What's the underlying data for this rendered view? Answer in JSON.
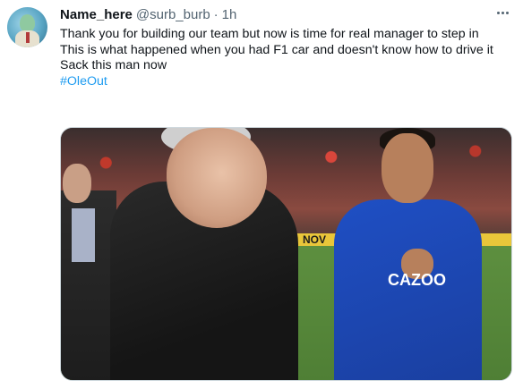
{
  "tweet": {
    "name": "Name_here",
    "handle": "@surb_burb",
    "separator": "·",
    "time": "1h",
    "lines": [
      "Thank you for building our team but now is time for real manager to step in",
      "This is what happened when you had F1 car and doesn't know how to drive it",
      "Sack this man now"
    ],
    "hashtag": "#OleOut",
    "media": {
      "board_text": "NOV",
      "shirt_sponsor": "CAZOO"
    }
  },
  "icons": {
    "avatar": "avatar-illustration",
    "more": "more-options-icon"
  },
  "colors": {
    "name": "#0f1419",
    "meta": "#536471",
    "hashtag": "#1d9bf0",
    "media_border": "#cfd9de"
  }
}
